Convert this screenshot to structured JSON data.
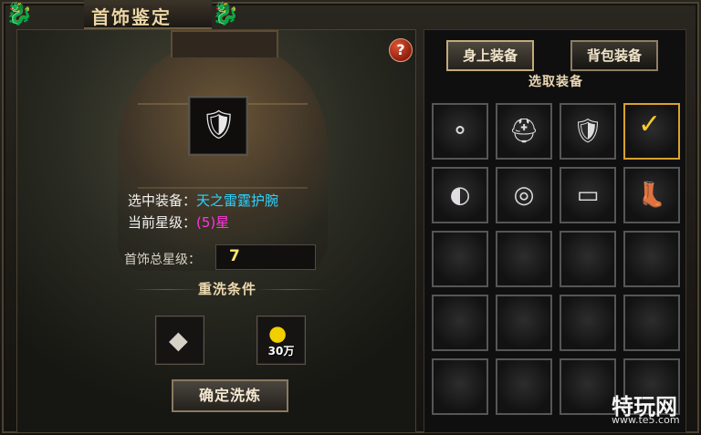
{
  "window": {
    "title": "首饰鉴定"
  },
  "left_panel": {
    "help_icon": "question-icon",
    "preview_icon": "bracer-icon",
    "selected_label": "选中装备：",
    "selected_value": "天之雷霆护腕",
    "star_label": "当前星级：",
    "star_value": "(5)星",
    "total_label": "首饰总星级：",
    "total_value": "7",
    "section_title": "重洗条件",
    "requirements": [
      {
        "icon": "ore-icon"
      },
      {
        "icon": "gold-coin-icon",
        "amount": "30万"
      }
    ],
    "confirm_button": "确定洗炼"
  },
  "right_panel": {
    "tabs": [
      {
        "label": "身上装备",
        "active": true
      },
      {
        "label": "背包装备",
        "active": false
      }
    ],
    "section_title": "选取装备",
    "slots": [
      {
        "icon": "necklace-icon",
        "selected": false
      },
      {
        "icon": "helmet-icon",
        "selected": false
      },
      {
        "icon": "bracer-icon",
        "selected": false
      },
      {
        "icon": "checkmark-icon",
        "selected": true
      },
      {
        "icon": "bracelet-icon",
        "selected": false
      },
      {
        "icon": "ring-icon",
        "selected": false
      },
      {
        "icon": "belt-icon",
        "selected": false
      },
      {
        "icon": "boots-icon",
        "selected": false
      },
      {
        "icon": "empty-slot",
        "selected": false
      },
      {
        "icon": "empty-slot",
        "selected": false
      },
      {
        "icon": "empty-slot",
        "selected": false
      },
      {
        "icon": "empty-slot",
        "selected": false
      },
      {
        "icon": "empty-slot",
        "selected": false
      },
      {
        "icon": "empty-slot",
        "selected": false
      },
      {
        "icon": "empty-slot",
        "selected": false
      },
      {
        "icon": "empty-slot",
        "selected": false
      },
      {
        "icon": "empty-slot",
        "selected": false
      },
      {
        "icon": "empty-slot",
        "selected": false
      },
      {
        "icon": "empty-slot",
        "selected": false
      },
      {
        "icon": "empty-slot",
        "selected": false
      }
    ]
  },
  "watermark": {
    "big": "特玩网",
    "small": "www.te5.com"
  }
}
